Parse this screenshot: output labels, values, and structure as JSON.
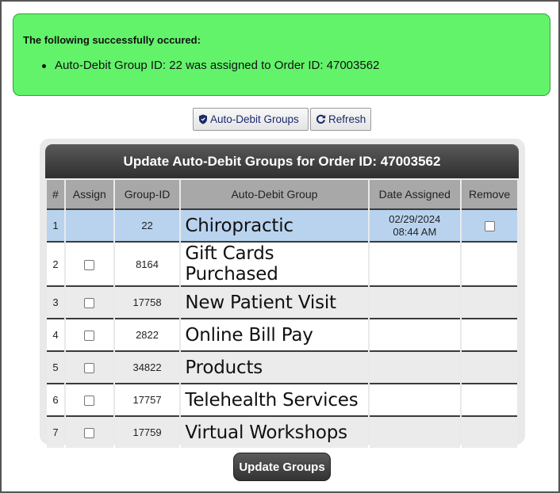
{
  "notice": {
    "title": "The following successfully occured:",
    "messages": [
      "Auto-Debit Group ID: 22 was assigned to Order ID: 47003562"
    ],
    "background_color": "#62f36a"
  },
  "toolbar": {
    "groups_label": "Auto-Debit Groups",
    "groups_icon": "shield-icon",
    "refresh_label": "Refresh",
    "refresh_icon": "refresh-icon"
  },
  "panel": {
    "title": "Update Auto-Debit Groups for Order ID: 47003562",
    "columns": [
      "#",
      "Assign",
      "Group-ID",
      "Auto-Debit Group",
      "Date Assigned",
      "Remove"
    ],
    "rows": [
      {
        "num": "1",
        "group_id": "22",
        "name": "Chiropractic",
        "date": "02/29/2024",
        "time": "08:44 AM",
        "assigned": true
      },
      {
        "num": "2",
        "group_id": "8164",
        "name": "Gift Cards Purchased",
        "date": "",
        "time": "",
        "assigned": false
      },
      {
        "num": "3",
        "group_id": "17758",
        "name": "New Patient Visit",
        "date": "",
        "time": "",
        "assigned": false
      },
      {
        "num": "4",
        "group_id": "2822",
        "name": "Online Bill Pay",
        "date": "",
        "time": "",
        "assigned": false
      },
      {
        "num": "5",
        "group_id": "34822",
        "name": "Products",
        "date": "",
        "time": "",
        "assigned": false
      },
      {
        "num": "6",
        "group_id": "17757",
        "name": "Telehealth Services",
        "date": "",
        "time": "",
        "assigned": false
      },
      {
        "num": "7",
        "group_id": "17759",
        "name": "Virtual Workshops",
        "date": "",
        "time": "",
        "assigned": false
      }
    ],
    "selected_row_color": "#b9d3ef"
  },
  "footer": {
    "update_label": "Update Groups"
  }
}
